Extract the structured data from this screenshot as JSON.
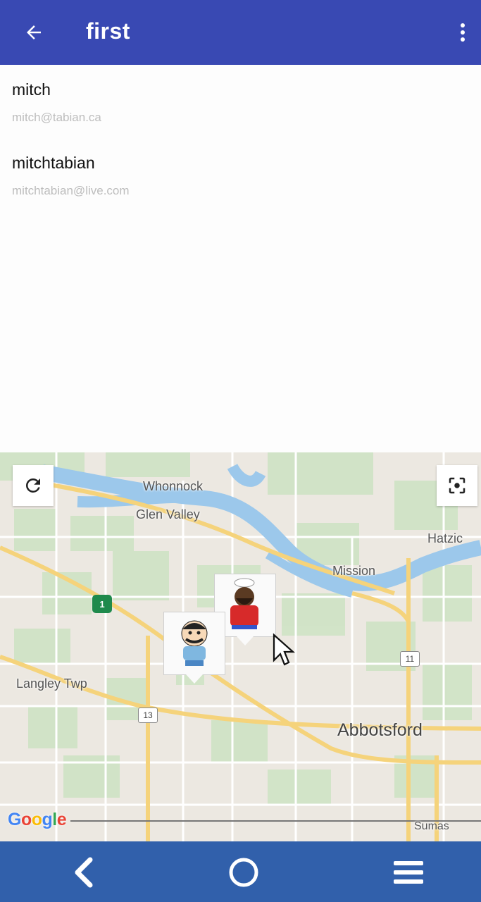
{
  "app_bar": {
    "title": "first",
    "back_icon": "arrow-left-icon",
    "menu_icon": "more-vert-icon",
    "color": "#3949b3"
  },
  "users": [
    {
      "username": "mitch",
      "email": "mitch@tabian.ca"
    },
    {
      "username": "mitchtabian",
      "email": "mitchtabian@live.com"
    }
  ],
  "map": {
    "labels": {
      "whonnock": "Whonnock",
      "glen_valley": "Glen Valley",
      "hatzic": "Hatzic",
      "mission": "Mission",
      "langley": "Langley Twp",
      "abbotsford": "Abbotsford",
      "sumas": "Sumas"
    },
    "route_shields": {
      "hwy1": "1",
      "hwy11": "11",
      "hwy13": "13"
    },
    "reset_button_icon": "refresh-icon",
    "recenter_button_icon": "center-focus-icon",
    "attribution": "Google",
    "markers": [
      "chef-avatar-marker",
      "ike-avatar-marker"
    ]
  },
  "nav_bar": {
    "back": "back-icon",
    "home": "home-icon",
    "menu": "menu-icon",
    "color": "#3160ab"
  }
}
